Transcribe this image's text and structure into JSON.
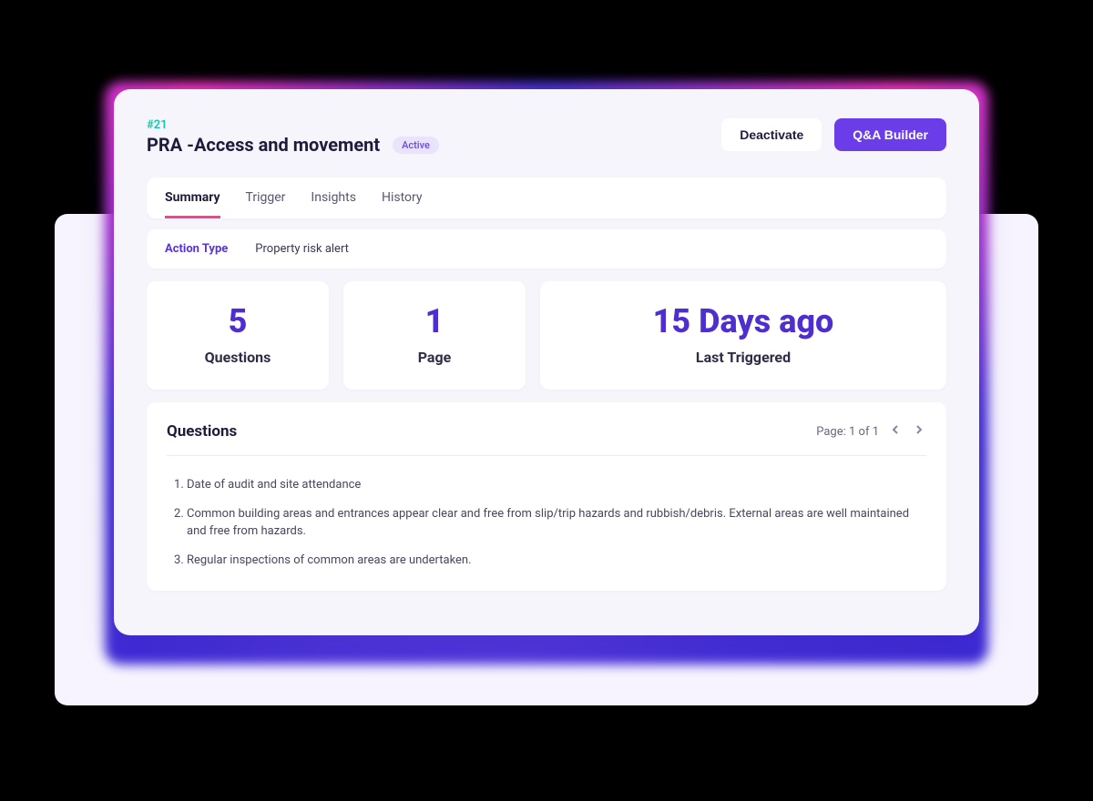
{
  "header": {
    "id_tag": "#21",
    "title": "PRA -Access and movement",
    "status_badge": "Active",
    "deactivate_label": "Deactivate",
    "builder_label": "Q&A Builder"
  },
  "tabs": {
    "summary": "Summary",
    "trigger": "Trigger",
    "insights": "Insights",
    "history": "History"
  },
  "action_type": {
    "label": "Action Type",
    "value": "Property risk alert"
  },
  "stats": {
    "questions_value": "5",
    "questions_label": "Questions",
    "page_value": "1",
    "page_label": "Page",
    "last_triggered_value": "15 Days ago",
    "last_triggered_label": "Last Triggered"
  },
  "questions": {
    "title": "Questions",
    "pager_text": "Page: 1 of 1",
    "items": {
      "0": "Date of audit and site attendance",
      "1": "Common building areas and entrances appear clear and free from slip/trip hazards and rubbish/debris. External areas are well maintained and free from hazards.",
      "2": "Regular inspections of common areas are undertaken."
    }
  }
}
